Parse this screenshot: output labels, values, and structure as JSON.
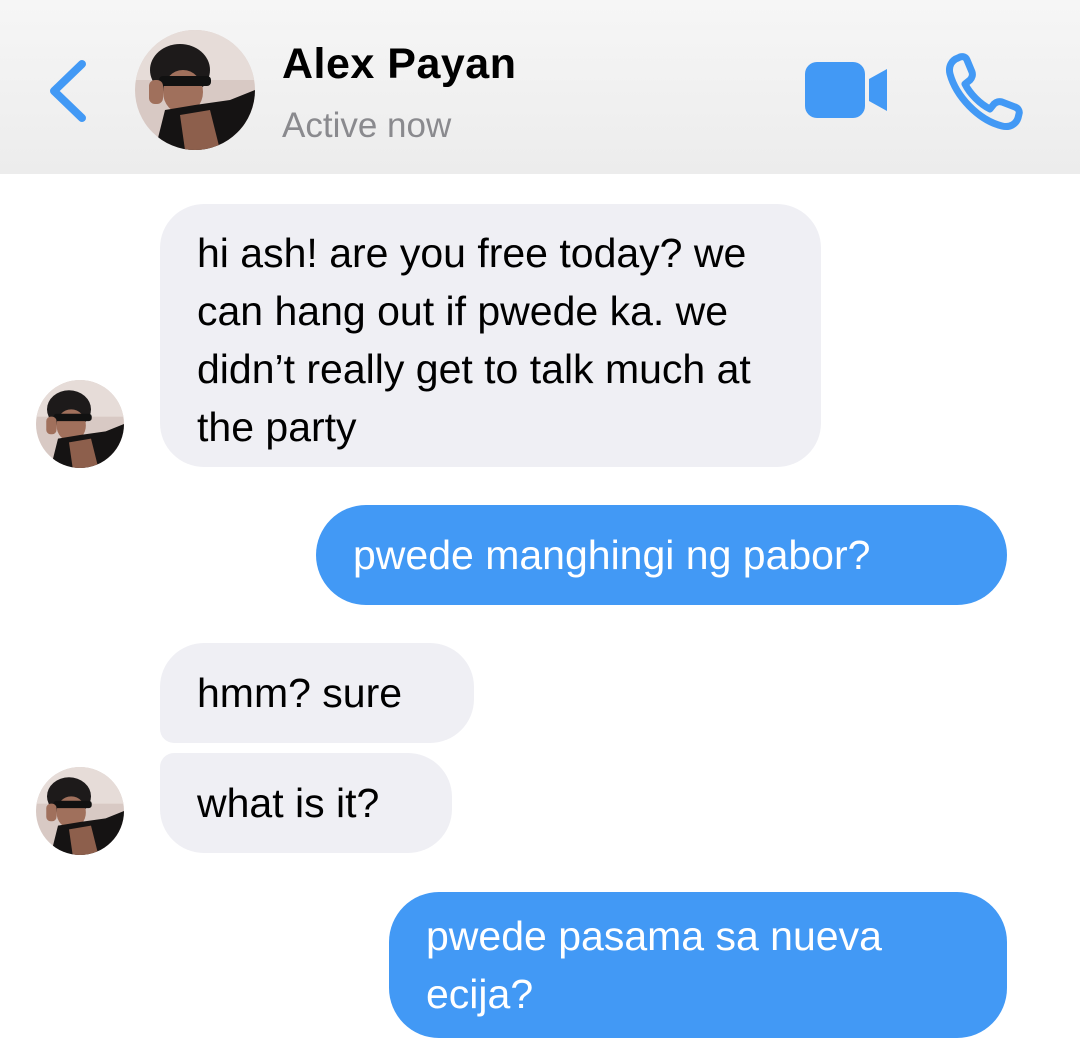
{
  "header": {
    "contact_name": "Alex Payan",
    "status": "Active now",
    "accent_color": "#4299f5",
    "icons": [
      "chevron-left-icon",
      "avatar",
      "video-camera-icon",
      "phone-icon"
    ]
  },
  "messages": [
    {
      "direction": "incoming",
      "text": "hi ash! are you free today? we can hang out if pwede ka. we didn’t really get to talk much at the party"
    },
    {
      "direction": "outgoing",
      "text": "pwede manghingi ng pabor?"
    },
    {
      "direction": "incoming",
      "text": "hmm? sure"
    },
    {
      "direction": "incoming",
      "text": "what is it?"
    },
    {
      "direction": "outgoing",
      "text": "pwede pasama sa nueva ecija?"
    }
  ],
  "colors": {
    "incoming_bubble": "#efeff4",
    "outgoing_bubble": "#4299f5",
    "status_text": "#8a8a8e"
  }
}
